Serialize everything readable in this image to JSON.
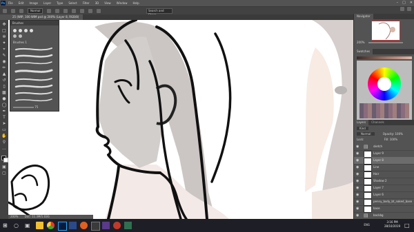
{
  "menubar": {
    "app_icon": "Ps",
    "items": [
      "File",
      "Edit",
      "Image",
      "Layer",
      "Type",
      "Select",
      "Filter",
      "3D",
      "View",
      "Window",
      "Help"
    ]
  },
  "options": {
    "mode_label": "Normal",
    "search_placeholder": "Search and Share"
  },
  "document": {
    "tab_title": "25 (WIP, 100 WIM psd @ 200% (Layer 8, RGB/8)"
  },
  "brushes": {
    "title": "Brushes",
    "group_label": "Brushes 1",
    "size_value": "75"
  },
  "navigator": {
    "title": "Navigator",
    "zoom": "200%"
  },
  "swatches": {
    "title": "Swatches"
  },
  "layers": {
    "tabs": [
      "Layers",
      "Channels"
    ],
    "kind_label": "Kind",
    "blend_mode": "Normal",
    "opacity_label": "Opacity:",
    "opacity_value": "100%",
    "lock_label": "Lock:",
    "fill_label": "Fill:",
    "fill_value": "100%",
    "items": [
      {
        "name": "sketch",
        "type": "folder",
        "active": false
      },
      {
        "name": "Layer 9",
        "type": "layer",
        "active": false
      },
      {
        "name": "Layer 8",
        "type": "layer",
        "active": true
      },
      {
        "name": "Line",
        "type": "layer",
        "active": false
      },
      {
        "name": "Hair",
        "type": "layer",
        "active": false
      },
      {
        "name": "Shadow 2",
        "type": "layer",
        "active": false
      },
      {
        "name": "Layer 7",
        "type": "layer",
        "active": false
      },
      {
        "name": "Layer 6",
        "type": "layer",
        "active": false
      },
      {
        "name": "penny_body_bt_naked_base",
        "type": "layer",
        "active": false
      },
      {
        "name": "base",
        "type": "layer",
        "active": false
      },
      {
        "name": "backbg",
        "type": "folder",
        "active": false
      }
    ]
  },
  "statusbar": {
    "zoom": "200%",
    "doc": "Doc: 11.3M/1.03G"
  },
  "taskbar": {
    "time": "3:16 PM",
    "date": "28/10/2019",
    "lang": "ENG"
  },
  "colors": {
    "accent": "#31a8ff",
    "panel": "#535353",
    "canvas": "#ffffff",
    "taskbar": "#1e1e26"
  }
}
